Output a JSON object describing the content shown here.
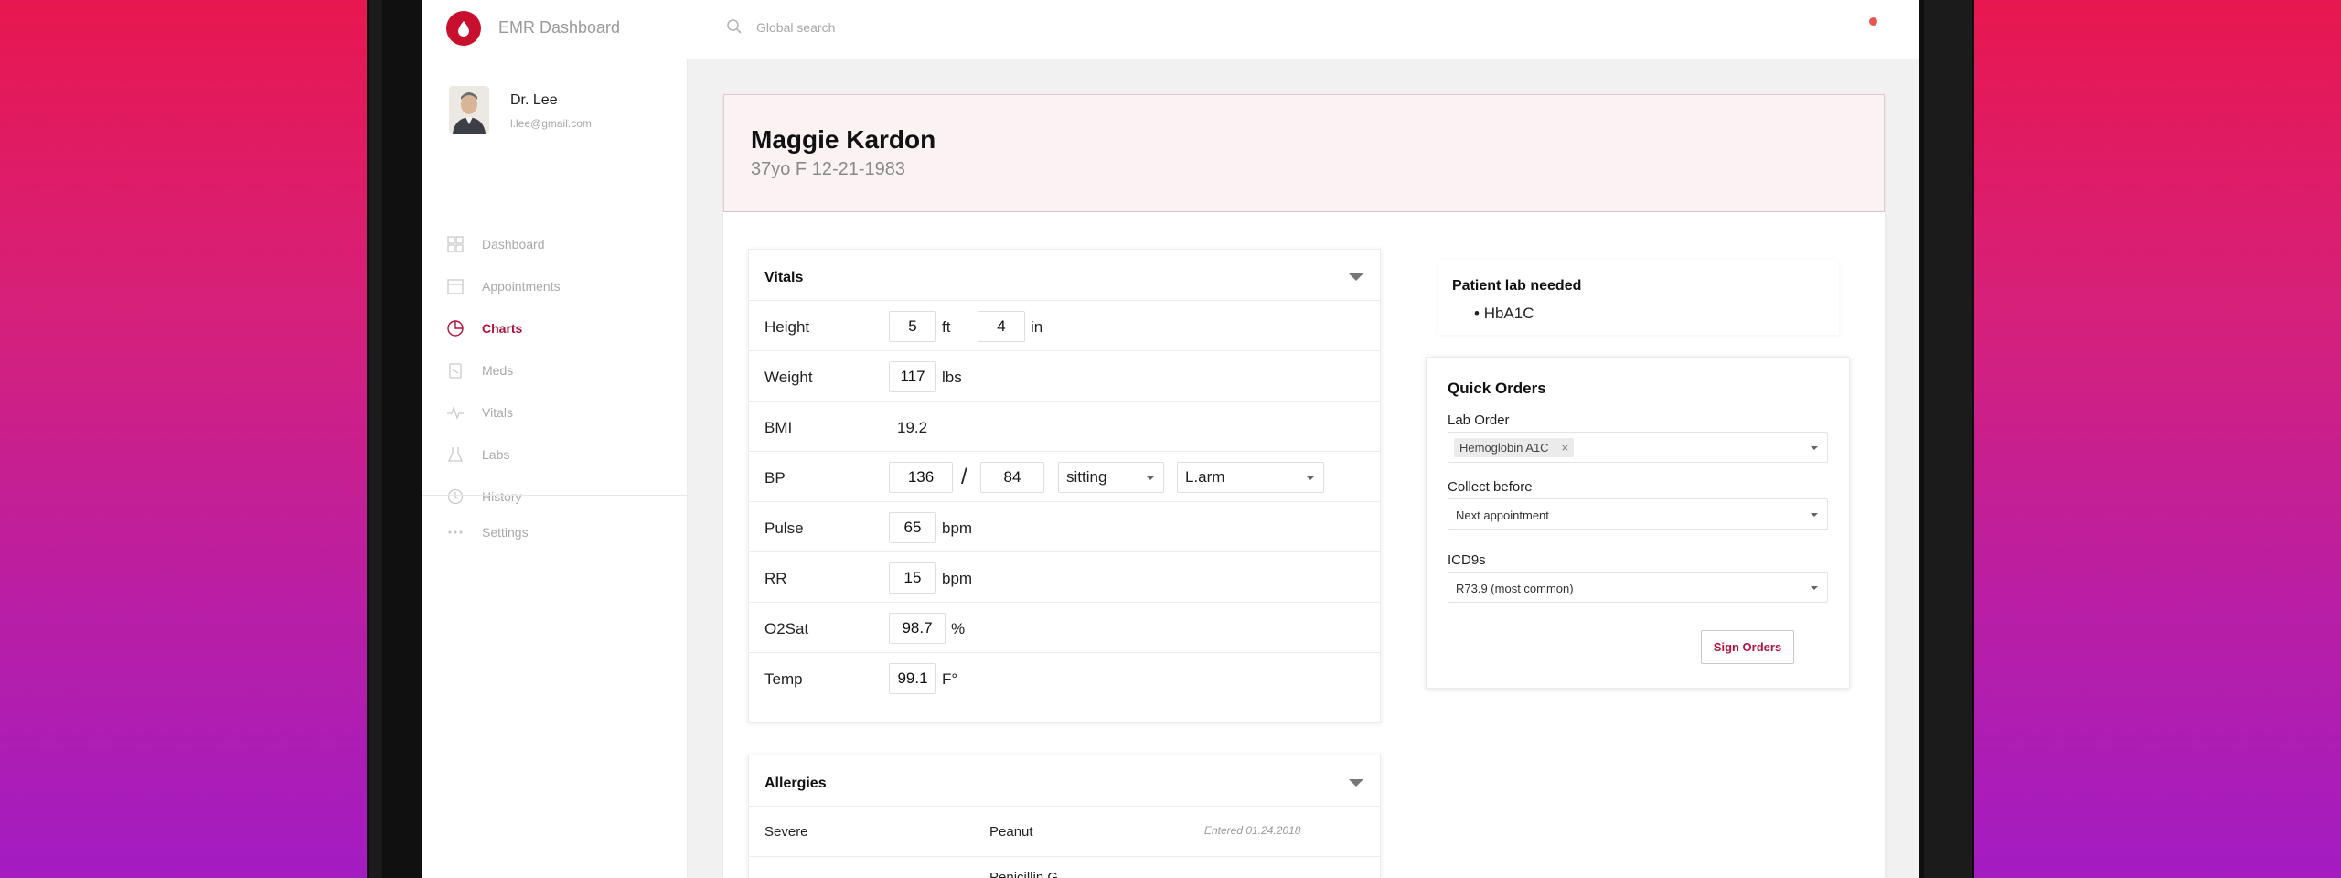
{
  "app": {
    "title": "EMR Dashboard",
    "search_placeholder": "Global search",
    "brand_color": "#c8102e",
    "accent_color": "#b0123a"
  },
  "user": {
    "name": "Dr. Lee",
    "email": "l.lee@gmail.com"
  },
  "sidebar": {
    "items": [
      {
        "label": "Dashboard",
        "icon": "grid-icon",
        "active": false
      },
      {
        "label": "Appointments",
        "icon": "calendar-icon",
        "active": false
      },
      {
        "label": "Charts",
        "icon": "pie-chart-icon",
        "active": true
      },
      {
        "label": "Meds",
        "icon": "pill-bottle-icon",
        "active": false
      },
      {
        "label": "Vitals",
        "icon": "pulse-icon",
        "active": false
      },
      {
        "label": "Labs",
        "icon": "flask-icon",
        "active": false
      },
      {
        "label": "History",
        "icon": "history-icon",
        "active": false
      }
    ],
    "settings_label": "Settings"
  },
  "patient": {
    "name": "Maggie Kardon",
    "meta": "37yo F 12-21-1983"
  },
  "vitals": {
    "title": "Vitals",
    "height": {
      "label": "Height",
      "ft": "5",
      "ft_unit": "ft",
      "in": "4",
      "in_unit": "in"
    },
    "weight": {
      "label": "Weight",
      "value": "117",
      "unit": "lbs"
    },
    "bmi": {
      "label": "BMI",
      "value": "19.2"
    },
    "bp": {
      "label": "BP",
      "systolic": "136",
      "separator": "/",
      "diastolic": "84",
      "position": "sitting",
      "site": "L.arm"
    },
    "pulse": {
      "label": "Pulse",
      "value": "65",
      "unit": "bpm"
    },
    "rr": {
      "label": "RR",
      "value": "15",
      "unit": "bpm"
    },
    "o2sat": {
      "label": "O2Sat",
      "value": "98.7",
      "unit": "%"
    },
    "temp": {
      "label": "Temp",
      "value": "99.1",
      "unit": "F°"
    }
  },
  "allergies": {
    "title": "Allergies",
    "rows": [
      {
        "severity": "Severe",
        "allergen": "Peanut",
        "entered": "Entered 01.24.2018"
      },
      {
        "severity": "",
        "allergen": "Penicillin G",
        "entered": ""
      }
    ]
  },
  "lab_needed": {
    "title": "Patient lab needed",
    "items": [
      "HbA1C"
    ]
  },
  "quick_orders": {
    "title": "Quick Orders",
    "lab_order_label": "Lab Order",
    "lab_order_tag": "Hemoglobin A1C",
    "collect_before_label": "Collect before",
    "collect_before_value": "Next appointment",
    "icd_label": "ICD9s",
    "icd_value": "R73.9 (most common)",
    "sign_button": "Sign Orders"
  }
}
